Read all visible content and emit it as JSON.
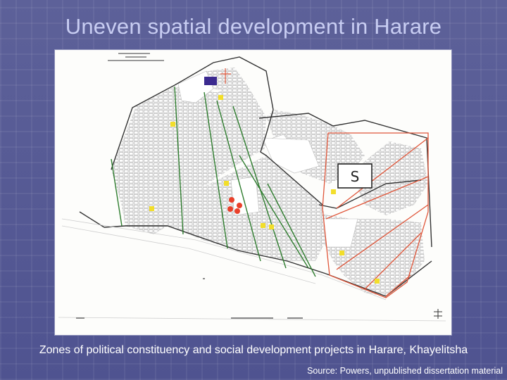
{
  "slide": {
    "title": "Uneven spatial development in Harare",
    "caption": "Zones of political constituency and social development projects in Harare, Khayelitsha",
    "source": "Source: Powers, unpublished dissertation material"
  },
  "map": {
    "zone_label": "S",
    "zone_line_color": "#2f7d2f",
    "project_zone_color": "#e0563a",
    "marker_yellow": "#f2de2a",
    "marker_red": "#e9402a",
    "marker_purple": "#3b2a8f"
  }
}
